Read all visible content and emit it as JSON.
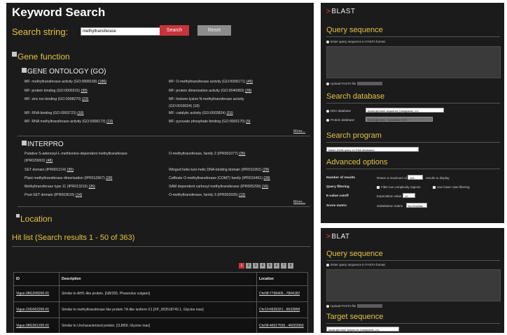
{
  "keyword": {
    "title": "Keyword Search",
    "search_label": "Search string:",
    "search_value": "methyltransferase",
    "search_button": "Search",
    "reset_button": "Reset",
    "gene_function_title": "Gene function",
    "go_title": "GENE ONTOLOGY (GO)",
    "go_left": [
      {
        "text": "MF: methyltransferase activity (GO:0008168) ",
        "count": "(186)"
      },
      {
        "text": "MF: protein binding (GO:0005515) ",
        "count": "(39)"
      },
      {
        "text": "MF: zinc ion binding (GO:0008270) ",
        "count": "(23)"
      },
      {
        "text": "",
        "count": ""
      },
      {
        "text": "MF: RNA binding (GO:0003723) ",
        "count": "(18)"
      },
      {
        "text": "MF: RNA methyltransferase activity (GO:0008173) ",
        "count": "(13)"
      }
    ],
    "go_right": [
      {
        "text": "MF: O-methyltransferase activity (GO:0008171) ",
        "count": "(49)"
      },
      {
        "text": "MF: protein dimerization activity (GO:0046983) ",
        "count": "(28)"
      },
      {
        "text": "MF: histone-lysine N-methyltransferase activity",
        "count": ""
      },
      {
        "text": "(GO:0018024) (18)",
        "count": ""
      },
      {
        "text": "MF: catalytic activity (GO:0003824) ",
        "count": "(15)"
      },
      {
        "text": "MF: pyruvate phosphate binding (GO:0000170) ",
        "count": "(9)"
      }
    ],
    "more_label": "More...",
    "interpro_title": "INTERPRO",
    "ip_left": [
      {
        "text": "Putative S-adenosyl-L-methionine-dependent methyltransferase",
        "count": ""
      },
      {
        "text": "(IPR029063) ",
        "count": "(48)"
      },
      {
        "text": "SET domain (IPR001214) ",
        "count": "(30)"
      },
      {
        "text": "Plant methyltransferase dimerisation (IPR012967) ",
        "count": "(28)"
      },
      {
        "text": "Methyltransferase type 11 (IPR013216) ",
        "count": "(26)"
      },
      {
        "text": "Post-SET domain (IPR003616) ",
        "count": "(14)"
      }
    ],
    "ip_right": [
      {
        "text": "O-methyltransferase, family 2 (IPR001077) ",
        "count": "(35)"
      },
      {
        "text": "",
        "count": ""
      },
      {
        "text": "Winged helix-turn-helix DNA-binding domain (IPR011991) ",
        "count": "(29)"
      },
      {
        "text": "Caffeate O-methyltransferase (COMT) family (IPR016461) ",
        "count": "(28)"
      },
      {
        "text": "SAM dependent carboxyl methyltransferase (IPR005299) ",
        "count": "(16)"
      },
      {
        "text": "O-methyltransferase, family 3 (IPR002935) ",
        "count": "(13)"
      }
    ],
    "location_title": "Location",
    "hitlist_title": "Hit list (Search results 1 - 50 of 363)",
    "pages": [
      "1",
      "2",
      "3",
      "4",
      "5",
      "6",
      "7",
      "8"
    ],
    "table": {
      "headers": [
        "ID",
        "Description",
        "Location"
      ],
      "rows": [
        {
          "id": "Vigun.08G208200.01",
          "desc": "Similar to AtH1-like protein. [GB/205, Phaseolus vulgaris]",
          "loc": "Chr08:7796406...7804182"
        },
        {
          "id": "Vigun.10G062200.01",
          "desc": "Similar to methyltransferase like protein 7A-like isoform X1 [XP_003518740.1, Glycine max]",
          "loc": "Chr10:6626321...6633958"
        },
        {
          "id": "Vigun.08G361200.01",
          "desc": "Similar to Uncharacterized protein. [I1J859, Glycine max]",
          "loc": "Chr08:46017550...46023956"
        }
      ]
    }
  },
  "blast": {
    "logo": "BLAST",
    "query_title": "Query sequence",
    "enter_label": "Enter query sequence in FASTA format",
    "upload_label": "Upload FASTA file",
    "db_title": "Search database",
    "dna_label": "DNA database",
    "dna_value": "Azuki genome sequence (Vangularis_v1)",
    "protein_label": "Protein database",
    "protein_value": "Azuki genome - translated CDS",
    "program_title": "Search program",
    "program_value": "blastn (DNA query vs DNA database)",
    "adv_title": "Advanced options",
    "num_results_label": "Number of results",
    "num_results_pre": "Return a maximum of",
    "num_results_value": "100",
    "num_results_post": "results to display",
    "filter_label": "Query filtering",
    "filter_opt1": "Filter low complexity regions",
    "filter_opt2": "Use lower case filtering",
    "evalue_label": "E-value cutoff",
    "evalue_pre": "Expectation value",
    "evalue_value": "10",
    "score_label": "Score matrix",
    "score_pre": "Substitution matrix",
    "score_value": "BLOSUM62"
  },
  "blat": {
    "logo": "BLAT",
    "query_title": "Query sequence",
    "enter_label": "Enter query sequence in FASTA format",
    "upload_label": "Upload FASTA file",
    "target_title": "Target sequence",
    "target_value": "Azuki genome sequence (Vangularis_v1)"
  },
  "colors": {
    "accent": "#e2c443",
    "search": "#c7343b",
    "panel": "#1b1b1b"
  }
}
